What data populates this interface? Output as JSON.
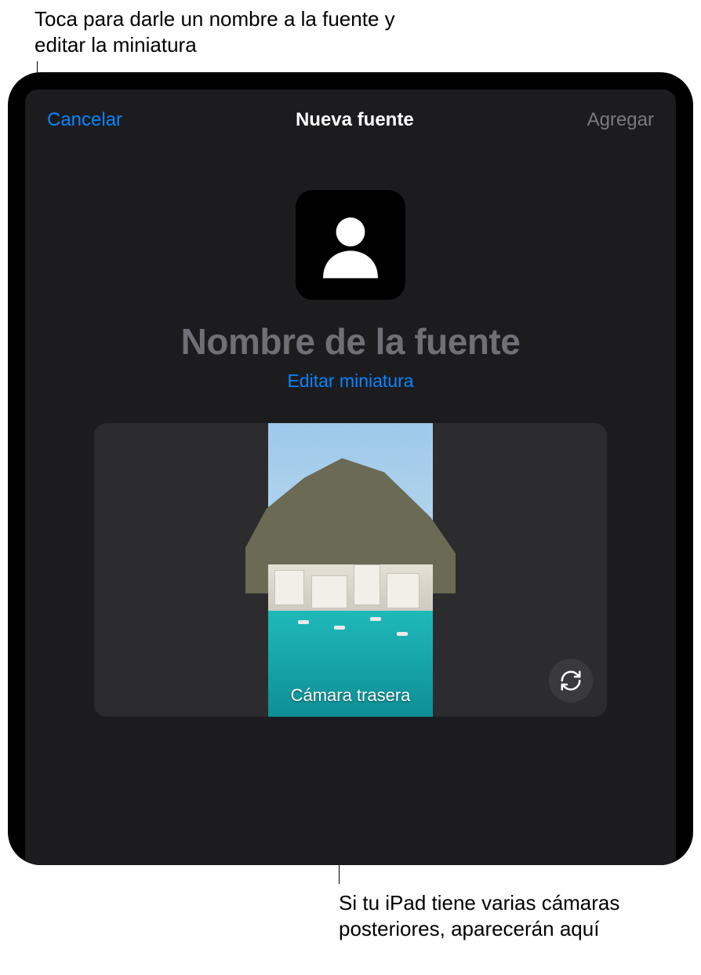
{
  "callouts": {
    "top": "Toca para darle un nombre a la fuente y editar la miniatura",
    "bottom": "Si tu iPad tiene varias cámaras posteriores, aparecerán aquí"
  },
  "modal": {
    "cancel_label": "Cancelar",
    "title": "Nueva fuente",
    "add_label": "Agregar",
    "source_name_placeholder": "Nombre de la fuente",
    "edit_thumbnail_label": "Editar miniatura",
    "camera_label": "Cámara trasera"
  },
  "icons": {
    "avatar": "person-placeholder-icon",
    "flip": "camera-flip-icon"
  },
  "colors": {
    "accent": "#0a84ff",
    "disabled": "#7a7a7e",
    "placeholder": "#6f6f75",
    "modal_bg": "#1c1c1e",
    "preview_bg": "#2c2c2e"
  }
}
